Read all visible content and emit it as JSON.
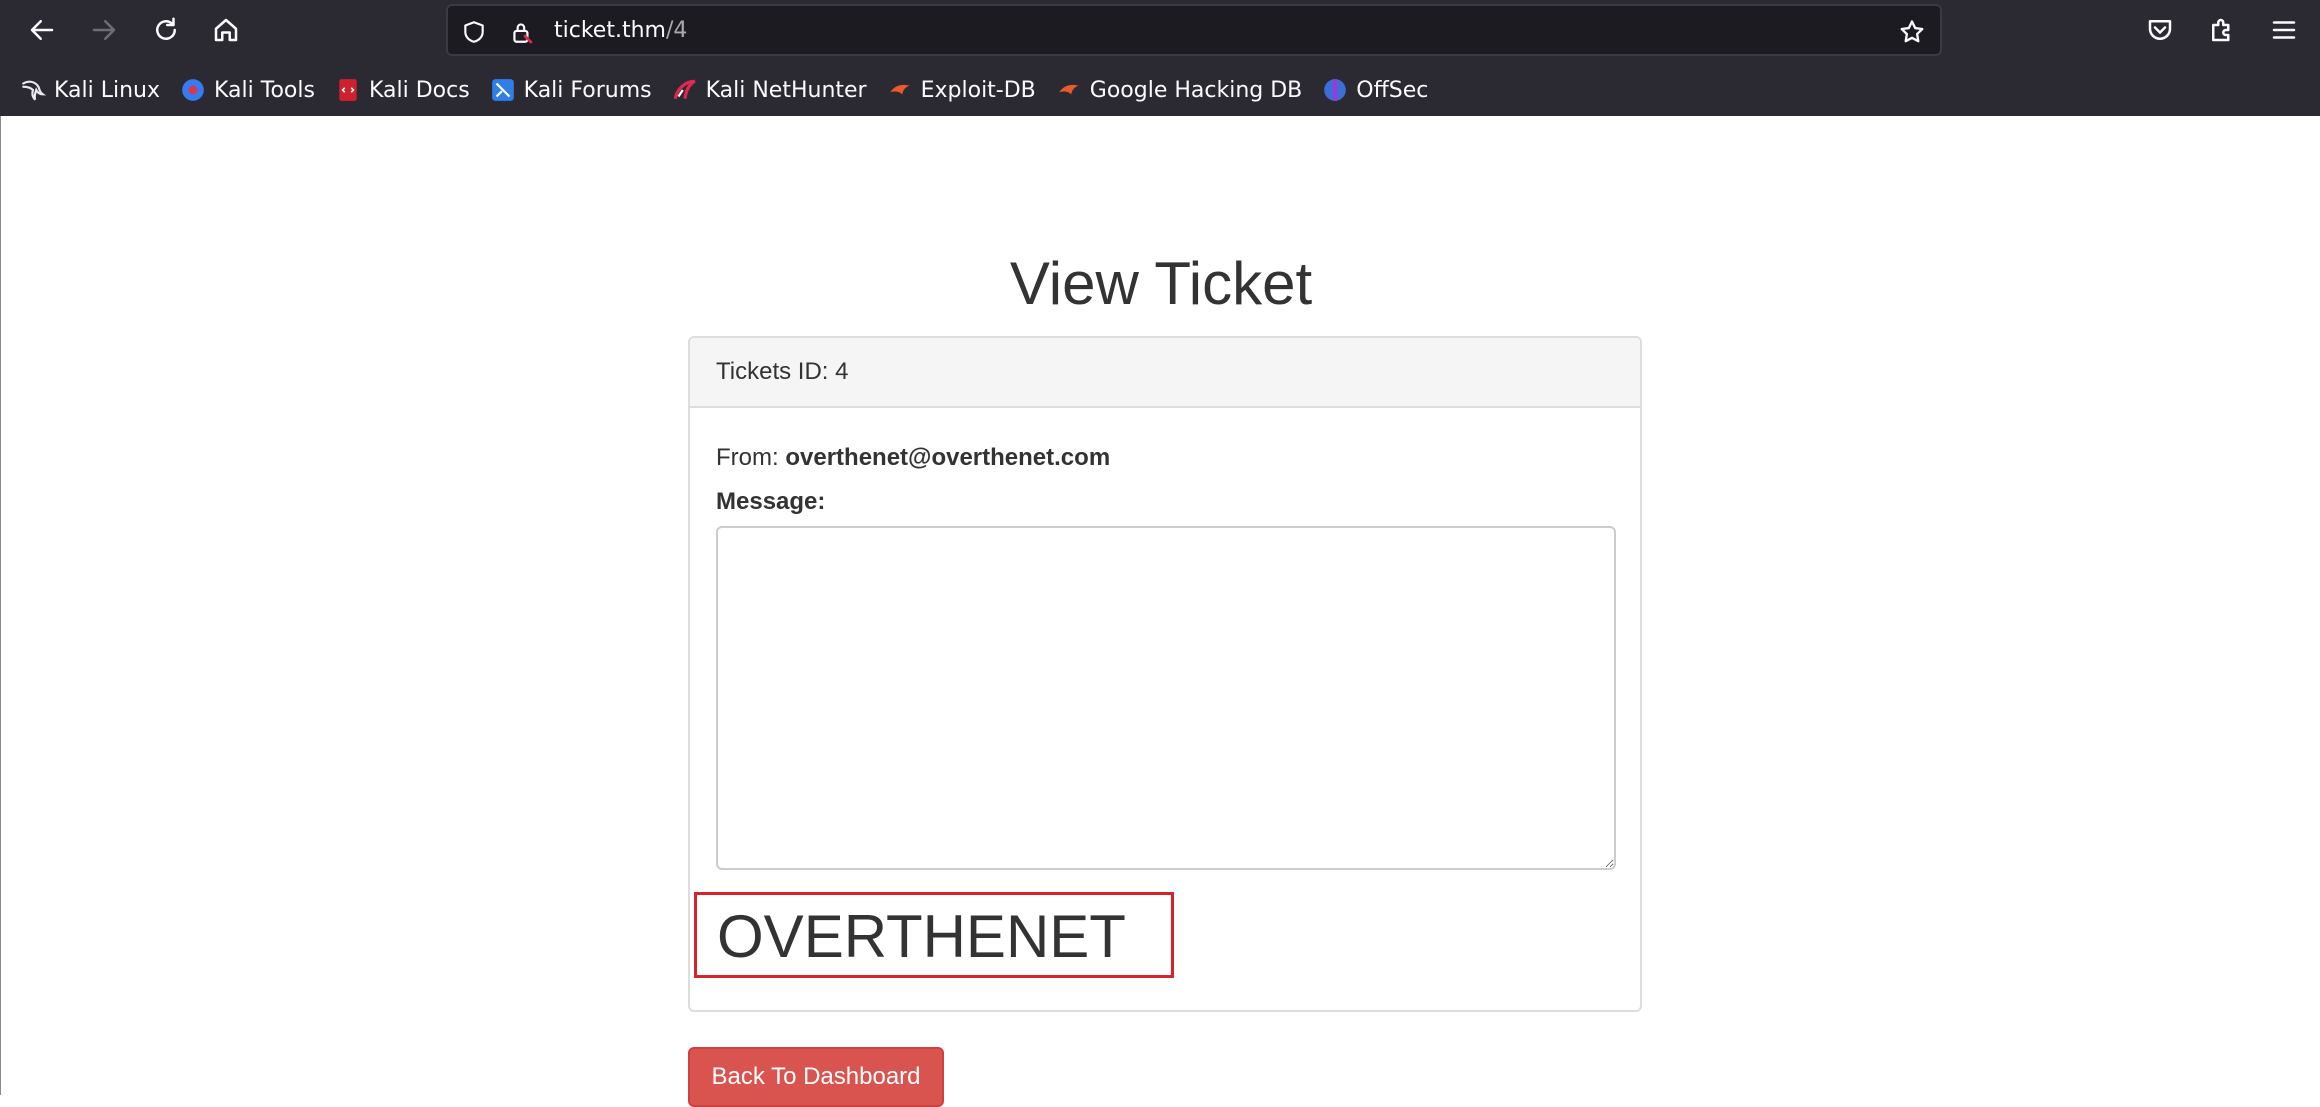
{
  "browser": {
    "url_host": "ticket.thm",
    "url_path": "/4",
    "bookmarks": [
      {
        "label": "Kali Linux",
        "icon": "kali-dragon-icon"
      },
      {
        "label": "Kali Tools",
        "icon": "kali-tools-icon"
      },
      {
        "label": "Kali Docs",
        "icon": "kali-docs-icon"
      },
      {
        "label": "Kali Forums",
        "icon": "kali-forums-icon"
      },
      {
        "label": "Kali NetHunter",
        "icon": "kali-nethunter-icon"
      },
      {
        "label": "Exploit-DB",
        "icon": "exploit-db-icon"
      },
      {
        "label": "Google Hacking DB",
        "icon": "ghdb-icon"
      },
      {
        "label": "OffSec",
        "icon": "offsec-icon"
      }
    ],
    "chrome_color": "#2b2a33"
  },
  "page": {
    "title": "View Ticket",
    "ticket_heading": "Tickets ID: 4",
    "from_label": "From:",
    "from_email": "overthenet@overthenet.com",
    "message_label": "Message:",
    "message_value": "",
    "injected_text": "OVERTHENET",
    "back_button": "Back To Dashboard",
    "accent_red": "#d9534f"
  }
}
